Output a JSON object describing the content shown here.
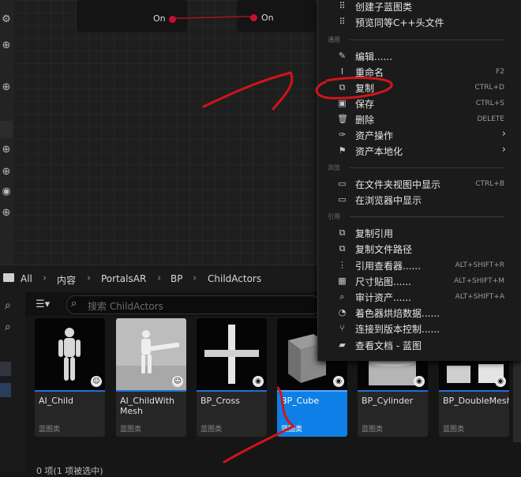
{
  "graph": {
    "pin_on_1": "On",
    "pin_on_2": "On"
  },
  "breadcrumb": [
    "All",
    "内容",
    "PortalsAR",
    "BP",
    "ChildActors"
  ],
  "search": {
    "placeholder": "搜索 ChildActors"
  },
  "assets": [
    {
      "name": "AI_Child",
      "type": "蓝图类",
      "selected": false
    },
    {
      "name": "AI_ChildWith Mesh",
      "type": "蓝图类",
      "selected": false
    },
    {
      "name": "BP_Cross",
      "type": "蓝图类",
      "selected": false
    },
    {
      "name": "BP_Cube",
      "type": "蓝图类",
      "selected": true
    },
    {
      "name": "BP_Cylinder",
      "type": "蓝图类",
      "selected": false
    },
    {
      "name": "BP_DoubleMesh",
      "type": "蓝图类",
      "selected": false
    }
  ],
  "status": "0 项(1 项被选中)",
  "menu": {
    "items_top": [
      {
        "label": "创建子蓝图类",
        "icon": "blueprint-child-icon"
      },
      {
        "label": "预览同等C++头文件",
        "icon": "cpp-header-icon"
      }
    ],
    "section_common": "通用",
    "items_common": [
      {
        "label": "编辑......",
        "shortcut": "",
        "icon": "edit-icon"
      },
      {
        "label": "重命名",
        "shortcut": "F2",
        "icon": "rename-icon"
      },
      {
        "label": "复制",
        "shortcut": "CTRL+D",
        "icon": "duplicate-icon"
      },
      {
        "label": "保存",
        "shortcut": "CTRL+S",
        "icon": "save-icon"
      },
      {
        "label": "删除",
        "shortcut": "DELETE",
        "icon": "trash-icon"
      },
      {
        "label": "资产操作",
        "shortcut": "",
        "icon": "wrench-icon",
        "submenu": true
      },
      {
        "label": "资产本地化",
        "shortcut": "",
        "icon": "flag-icon",
        "submenu": true
      }
    ],
    "section_explore": "浏览",
    "items_explore": [
      {
        "label": "在文件夹视图中显示",
        "shortcut": "CTRL+B",
        "icon": "folder-search-icon"
      },
      {
        "label": "在浏览器中显示",
        "shortcut": "",
        "icon": "folder-browse-icon"
      }
    ],
    "section_refs": "引用",
    "items_refs": [
      {
        "label": "复制引用",
        "shortcut": "",
        "icon": "copy-ref-icon"
      },
      {
        "label": "复制文件路径",
        "shortcut": "",
        "icon": "copy-path-icon"
      },
      {
        "label": "引用查看器......",
        "shortcut": "ALT+SHIFT+R",
        "icon": "ref-viewer-icon"
      },
      {
        "label": "尺寸贴图......",
        "shortcut": "ALT+SHIFT+M",
        "icon": "size-map-icon"
      },
      {
        "label": "审计资产......",
        "shortcut": "ALT+SHIFT+A",
        "icon": "audit-icon"
      },
      {
        "label": "着色器烘焙数据......",
        "shortcut": "",
        "icon": "shader-icon"
      },
      {
        "label": "连接到版本控制......",
        "shortcut": "",
        "icon": "source-control-icon"
      },
      {
        "label": "查看文档 - 蓝图",
        "shortcut": "",
        "icon": "docs-icon"
      }
    ]
  }
}
